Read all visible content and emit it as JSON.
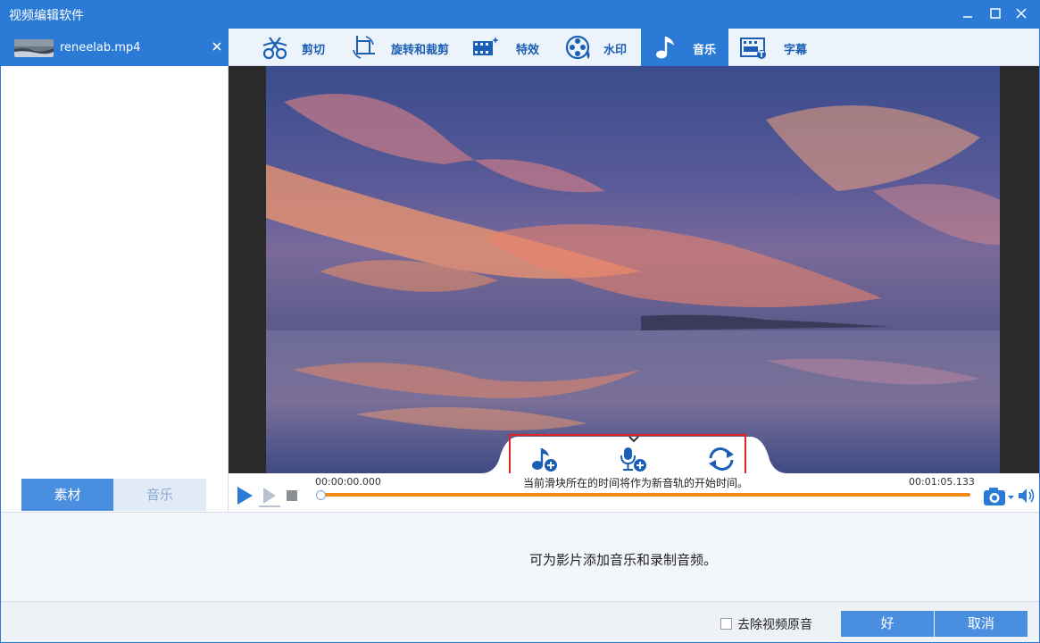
{
  "window": {
    "title": "视频编辑软件"
  },
  "file": {
    "name": "reneelab.mp4",
    "close_icon": "close-icon"
  },
  "left_tabs": [
    {
      "label": "素材",
      "active": true
    },
    {
      "label": "音乐",
      "active": false
    }
  ],
  "toolbar": {
    "tabs": [
      {
        "label": "剪切",
        "icon": "scissors-icon",
        "active": false
      },
      {
        "label": "旋转和裁剪",
        "icon": "rotate-crop-icon",
        "active": false
      },
      {
        "label": "特效",
        "icon": "effects-icon",
        "active": false
      },
      {
        "label": "水印",
        "icon": "watermark-icon",
        "active": false
      },
      {
        "label": "音乐",
        "icon": "music-note-icon",
        "active": true
      },
      {
        "label": "字幕",
        "icon": "subtitle-icon",
        "active": false
      }
    ]
  },
  "music_actions": [
    {
      "icon": "add-music-icon"
    },
    {
      "icon": "record-audio-icon"
    },
    {
      "icon": "replace-audio-icon"
    }
  ],
  "playback": {
    "time_start": "00:00:00.000",
    "time_end": "00:01:05.133",
    "hint": "当前滑块所在的时间将作为新音轨的开始时间。",
    "position_fraction": 0.0
  },
  "info": {
    "text": "可为影片添加音乐和录制音频。"
  },
  "footer": {
    "remove_audio_label": "去除视频原音",
    "remove_audio_checked": false,
    "ok_label": "好",
    "cancel_label": "取消"
  },
  "colors": {
    "accent": "#2a7ad6",
    "button": "#4a8ee0",
    "progress": "#f08a12",
    "highlight": "#e02424"
  }
}
